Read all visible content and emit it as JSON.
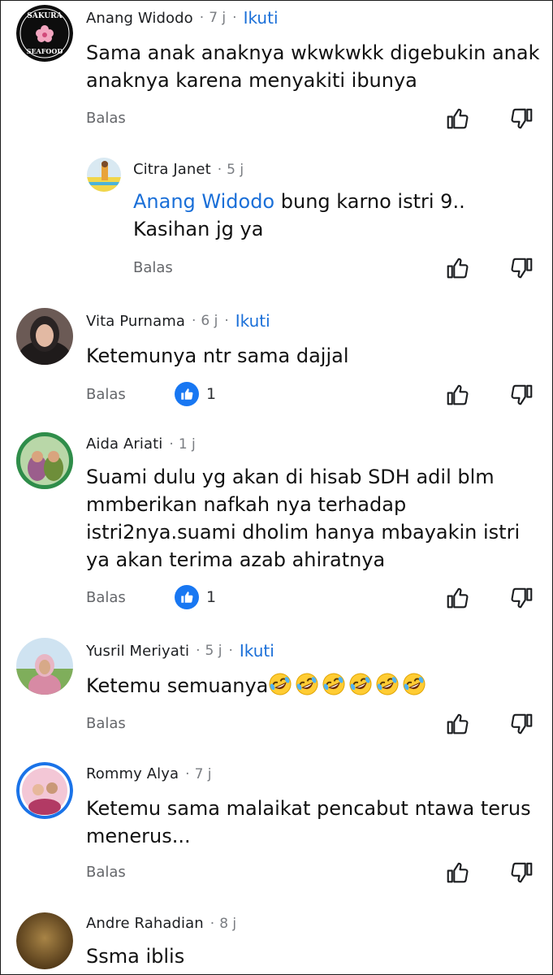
{
  "labels": {
    "reply": "Balas",
    "follow": "Ikuti",
    "separator": "·"
  },
  "comments": [
    {
      "author": "Anang Widodo",
      "time": "7 j",
      "follow": true,
      "text": "Sama anak anaknya wkwkwkk digebukin  anak anaknya karena menyakiti ibunya",
      "avatar_icon": "sakura-seafood-logo",
      "avatar_text_top": "SAKURA",
      "avatar_text_bottom": "SEAFOOD"
    },
    {
      "author": "Citra Janet",
      "time": "5 j",
      "follow": false,
      "reply_to": "Anang Widodo",
      "text": " bung karno istri 9.. Kasihan jg ya"
    },
    {
      "author": "Vita Purnama",
      "time": "6 j",
      "follow": true,
      "text": "Ketemunya ntr sama dajjal",
      "likes": "1"
    },
    {
      "author": "Aida Ariati",
      "time": "1 j",
      "follow": false,
      "text": "Suami dulu yg akan di hisab SDH adil blm mmberikan nafkah nya terhadap istri2nya.suami dholim hanya mbayakin istri ya akan terima azab ahiratnya",
      "likes": "1"
    },
    {
      "author": "Yusril Meriyati",
      "time": "5 j",
      "follow": true,
      "text": "Ketemu semuanya",
      "emoji": "rolling-on-floor-laughing",
      "emoji_count": 6
    },
    {
      "author": "Rommy Alya",
      "time": "7 j",
      "follow": false,
      "text": "Ketemu sama malaikat pencabut ntawa terus menerus..."
    },
    {
      "author": "Andre Rahadian",
      "time": "8 j",
      "follow": false,
      "text": "Ssma iblis"
    }
  ],
  "colors": {
    "accent": "#1a6fd8",
    "like_badge": "#1877f2",
    "muted": "#65676b"
  }
}
